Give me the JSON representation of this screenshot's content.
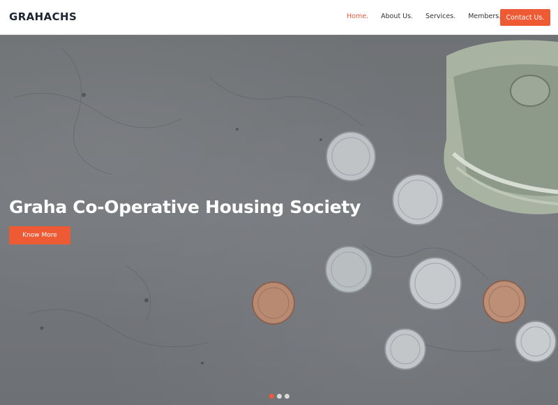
{
  "brand": {
    "name": "GRAHACHS"
  },
  "nav": {
    "items": [
      {
        "label": "Home.",
        "active": true
      },
      {
        "label": "About Us.",
        "active": false
      },
      {
        "label": "Services.",
        "active": false
      },
      {
        "label": "Members.",
        "active": false
      }
    ],
    "cta_label": "Contact Us."
  },
  "hero": {
    "title": "Graha Co-Operative Housing Society",
    "button_label": "Know More",
    "slides": {
      "count": 3,
      "active_index": 0
    }
  },
  "colors": {
    "accent": "#ee5a34",
    "active_nav": "#e8583a",
    "logo": "#1d2433"
  }
}
